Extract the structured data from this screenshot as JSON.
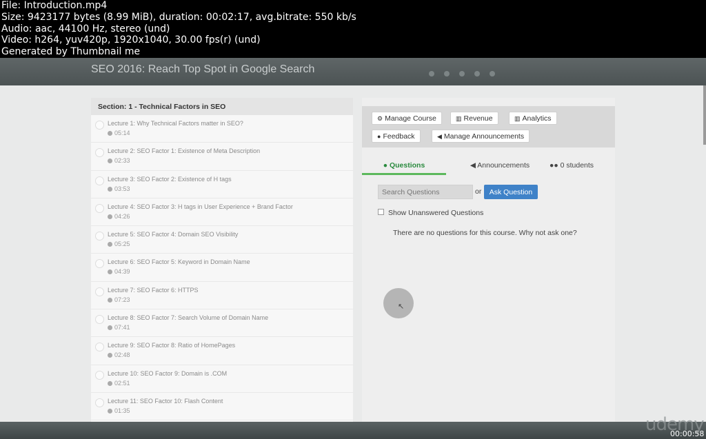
{
  "meta": {
    "lines": [
      "File: Introduction.mp4",
      "Size: 9423177 bytes (8.99 MiB), duration: 00:02:17, avg.bitrate: 550 kb/s",
      "Audio: aac, 44100 Hz, stereo (und)",
      "Video: h264, yuv420p, 1920x1040, 30.00 fps(r) (und)",
      "Generated by Thumbnail me"
    ]
  },
  "header": {
    "title": "SEO 2016: Reach Top Spot in Google Search"
  },
  "section": {
    "title": "Section: 1 - Technical Factors in SEO"
  },
  "lectures": [
    {
      "title": "Lecture 1: Why Technical Factors matter in SEO?",
      "duration": "05:14"
    },
    {
      "title": "Lecture 2: SEO Factor 1: Existence of Meta Description",
      "duration": "02:33"
    },
    {
      "title": "Lecture 3: SEO Factor 2: Existence of H tags",
      "duration": "03:53"
    },
    {
      "title": "Lecture 4: SEO Factor 3: H tags in User Experience + Brand Factor",
      "duration": "04:26"
    },
    {
      "title": "Lecture 5: SEO Factor 4: Domain SEO Visibility",
      "duration": "05:25"
    },
    {
      "title": "Lecture 6: SEO Factor 5: Keyword in Domain Name",
      "duration": "04:39"
    },
    {
      "title": "Lecture 7: SEO Factor 6: HTTPS",
      "duration": "07:23"
    },
    {
      "title": "Lecture 8: SEO Factor 7: Search Volume of Domain Name",
      "duration": "07:41"
    },
    {
      "title": "Lecture 9: SEO Factor 8: Ratio of HomePages",
      "duration": "02:48"
    },
    {
      "title": "Lecture 10: SEO Factor 9: Domain is .COM",
      "duration": "02:51"
    },
    {
      "title": "Lecture 11: SEO Factor 10: Flash Content",
      "duration": "01:35"
    },
    {
      "title": "",
      "duration": ""
    }
  ],
  "actions": {
    "manage_course": "Manage Course",
    "revenue": "Revenue",
    "analytics": "Analytics",
    "feedback": "Feedback",
    "manage_announcements": "Manage Announcements"
  },
  "tabs": {
    "questions": "Questions",
    "announcements": "Announcements",
    "students": "0 students"
  },
  "qa": {
    "search_placeholder": "Search Questions",
    "or": "or",
    "ask_button": "Ask Question",
    "show_unanswered": "Show Unanswered Questions",
    "empty_message": "There are no questions for this course. Why not ask one?"
  },
  "footer": {
    "brand": "udemy",
    "timestamp": "00:00:58"
  },
  "colors": {
    "accent_blue": "#3f82c8",
    "active_tab_green": "#5cb85c"
  }
}
